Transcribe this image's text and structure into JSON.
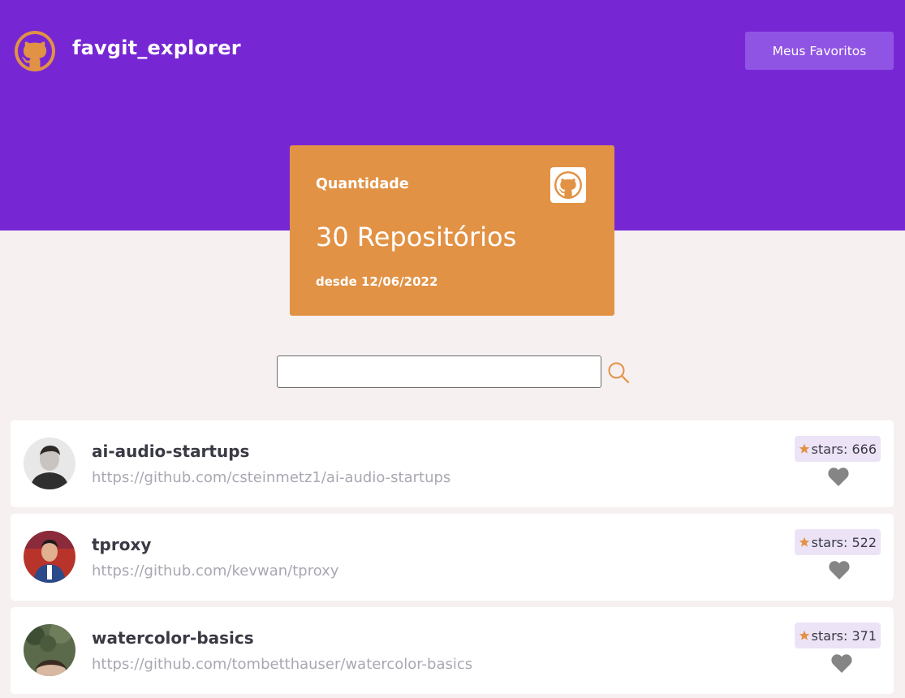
{
  "app": {
    "title": "favgit_explorer",
    "logo_icon": "github-octocat-icon"
  },
  "header": {
    "favorites_button": "Meus Favoritos"
  },
  "summary": {
    "label": "Quantidade",
    "count": "30 Repositórios",
    "since": "desde 12/06/2022",
    "icon": "github-icon"
  },
  "search": {
    "value": "",
    "placeholder": "",
    "icon": "search-icon"
  },
  "repos": [
    {
      "name": "ai-audio-startups",
      "url": "https://github.com/csteinmetz1/ai-audio-startups",
      "stars": "stars: 666",
      "favorite_icon": "heart-icon"
    },
    {
      "name": "tproxy",
      "url": "https://github.com/kevwan/tproxy",
      "stars": "stars: 522",
      "favorite_icon": "heart-icon"
    },
    {
      "name": "watercolor-basics",
      "url": "https://github.com/tombetthauser/watercolor-basics",
      "stars": "stars: 371",
      "favorite_icon": "heart-icon"
    }
  ],
  "colors": {
    "header_bg": "#7627d3",
    "accent_orange": "#e29245",
    "button_bg": "#9054e4",
    "page_bg": "#f6f0f1",
    "heart_gray": "#858585",
    "badge_bg": "#ece3f7"
  }
}
